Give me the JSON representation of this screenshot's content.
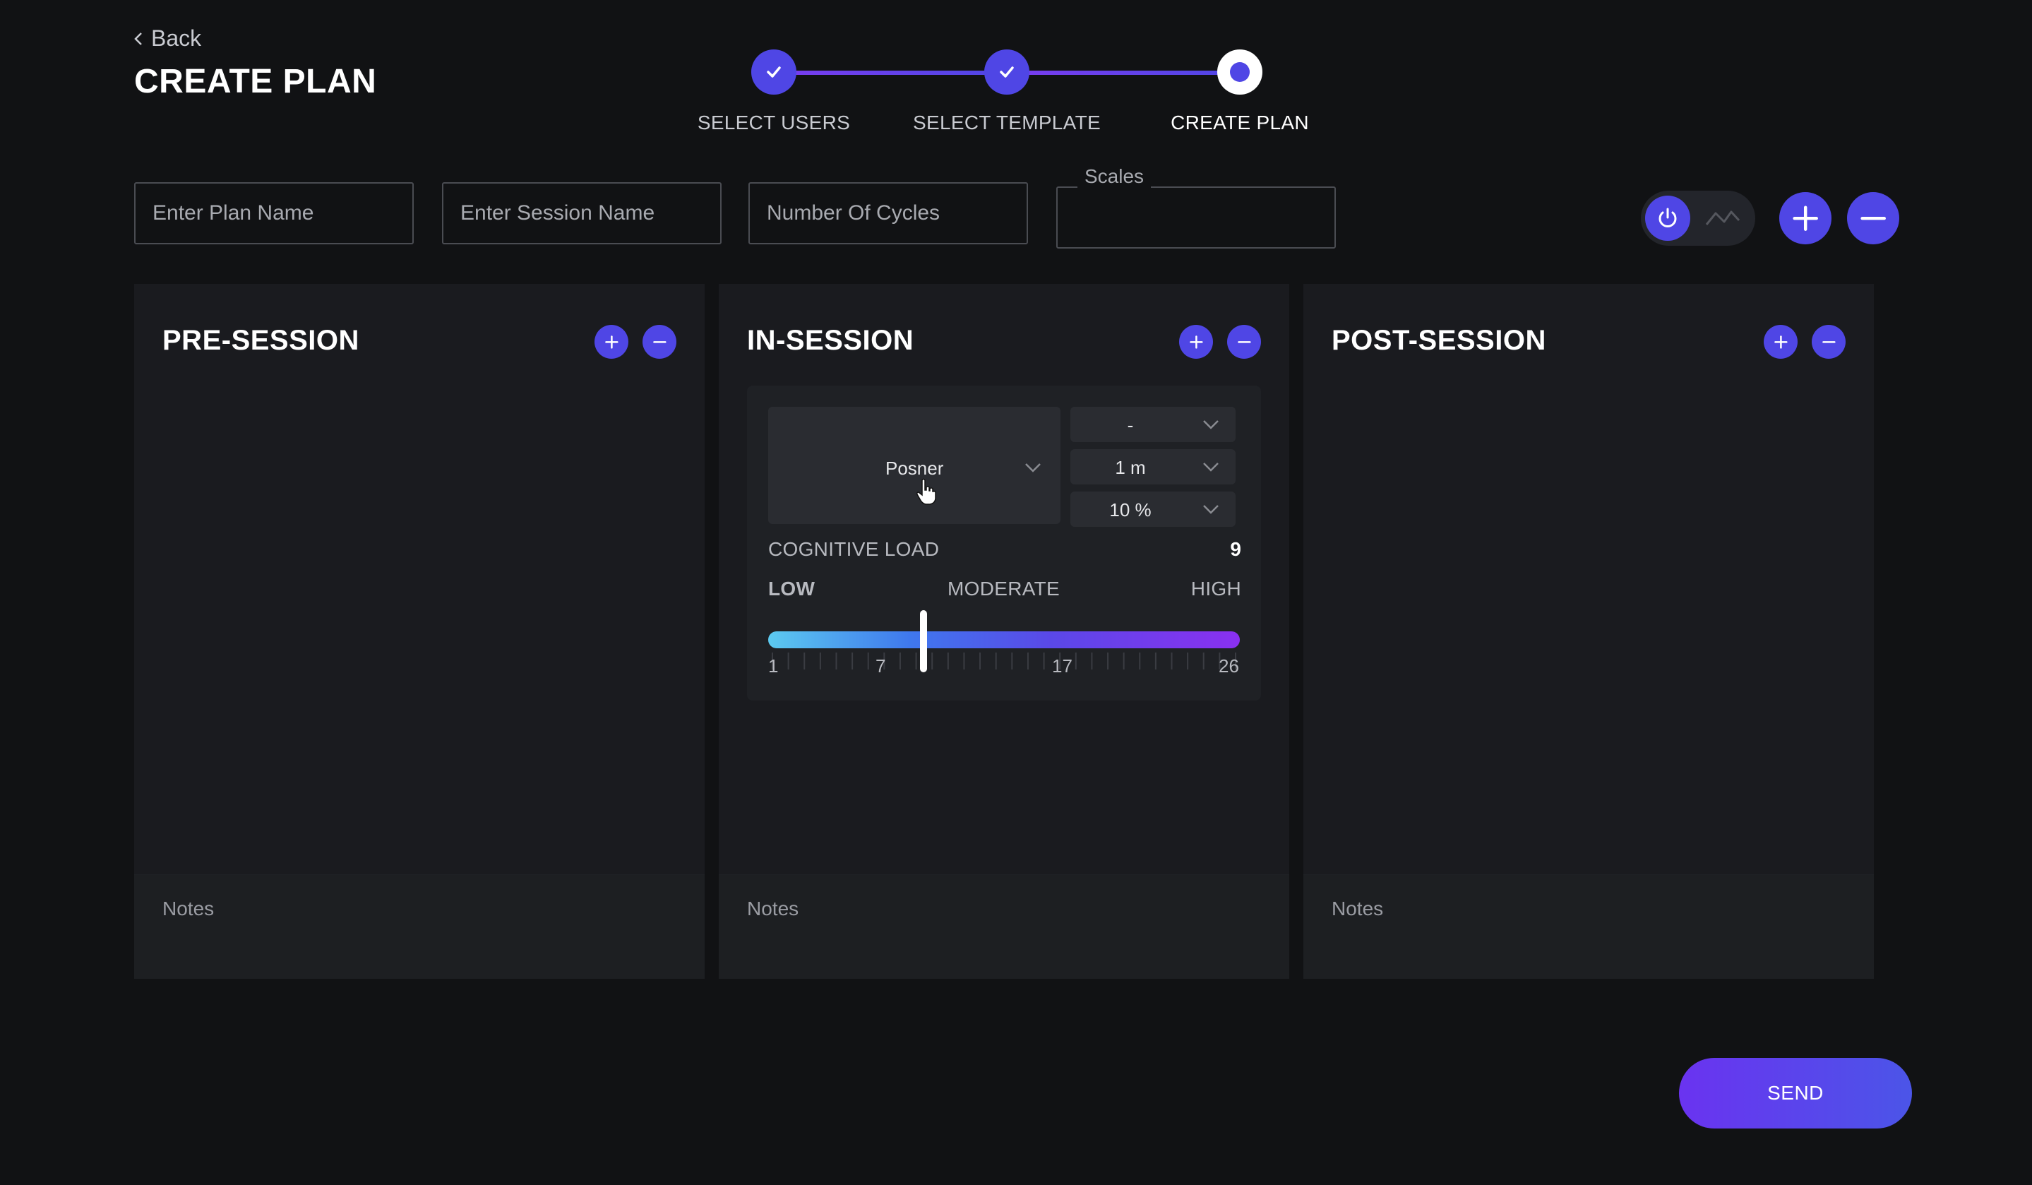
{
  "header": {
    "back_label": "Back",
    "title": "CREATE PLAN"
  },
  "stepper": {
    "steps": [
      {
        "label": "SELECT USERS",
        "status": "complete"
      },
      {
        "label": "SELECT TEMPLATE",
        "status": "complete"
      },
      {
        "label": "CREATE PLAN",
        "status": "current"
      }
    ]
  },
  "form": {
    "plan_name_placeholder": "Enter Plan Name",
    "session_name_placeholder": "Enter Session Name",
    "cycles_placeholder": "Number Of Cycles",
    "scales_label": "Scales"
  },
  "columns": [
    {
      "title": "PRE-SESSION",
      "notes_label": "Notes"
    },
    {
      "title": "IN-SESSION",
      "notes_label": "Notes",
      "card": {
        "activity": "Posner",
        "option_1": "-",
        "duration": "1 m",
        "percent": "10 %",
        "cognitive_load_label": "COGNITIVE LOAD",
        "cognitive_load_value": "9",
        "level_low": "LOW",
        "level_moderate": "MODERATE",
        "level_high": "HIGH",
        "slider": {
          "min": 1,
          "max": 26,
          "value": 9
        },
        "tick_labels": [
          "1",
          "7",
          "17",
          "26"
        ]
      }
    },
    {
      "title": "POST-SESSION",
      "notes_label": "Notes"
    }
  ],
  "actions": {
    "send_label": "SEND"
  },
  "colors": {
    "accent": "#4f46e5",
    "background": "#111214",
    "panel": "#1a1b1f"
  },
  "icons": [
    "chevron-left-icon",
    "check-icon",
    "power-icon",
    "trend-line-icon",
    "plus-icon",
    "minus-icon",
    "chevron-down-icon",
    "hand-pointer-icon"
  ]
}
